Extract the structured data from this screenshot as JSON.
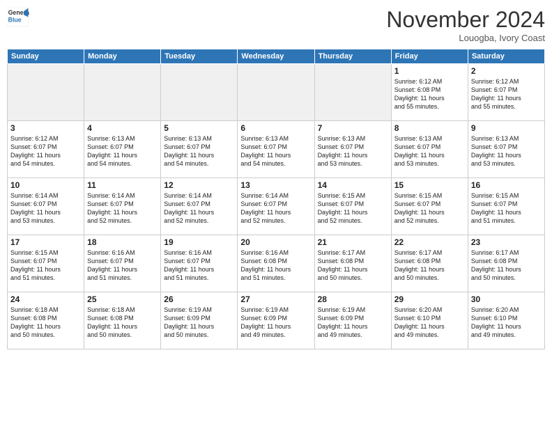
{
  "header": {
    "logo_line1": "General",
    "logo_line2": "Blue",
    "month": "November 2024",
    "location": "Louogba, Ivory Coast"
  },
  "weekdays": [
    "Sunday",
    "Monday",
    "Tuesday",
    "Wednesday",
    "Thursday",
    "Friday",
    "Saturday"
  ],
  "weeks": [
    [
      {
        "day": "",
        "info": ""
      },
      {
        "day": "",
        "info": ""
      },
      {
        "day": "",
        "info": ""
      },
      {
        "day": "",
        "info": ""
      },
      {
        "day": "",
        "info": ""
      },
      {
        "day": "1",
        "info": "Sunrise: 6:12 AM\nSunset: 6:08 PM\nDaylight: 11 hours\nand 55 minutes."
      },
      {
        "day": "2",
        "info": "Sunrise: 6:12 AM\nSunset: 6:07 PM\nDaylight: 11 hours\nand 55 minutes."
      }
    ],
    [
      {
        "day": "3",
        "info": "Sunrise: 6:12 AM\nSunset: 6:07 PM\nDaylight: 11 hours\nand 54 minutes."
      },
      {
        "day": "4",
        "info": "Sunrise: 6:13 AM\nSunset: 6:07 PM\nDaylight: 11 hours\nand 54 minutes."
      },
      {
        "day": "5",
        "info": "Sunrise: 6:13 AM\nSunset: 6:07 PM\nDaylight: 11 hours\nand 54 minutes."
      },
      {
        "day": "6",
        "info": "Sunrise: 6:13 AM\nSunset: 6:07 PM\nDaylight: 11 hours\nand 54 minutes."
      },
      {
        "day": "7",
        "info": "Sunrise: 6:13 AM\nSunset: 6:07 PM\nDaylight: 11 hours\nand 53 minutes."
      },
      {
        "day": "8",
        "info": "Sunrise: 6:13 AM\nSunset: 6:07 PM\nDaylight: 11 hours\nand 53 minutes."
      },
      {
        "day": "9",
        "info": "Sunrise: 6:13 AM\nSunset: 6:07 PM\nDaylight: 11 hours\nand 53 minutes."
      }
    ],
    [
      {
        "day": "10",
        "info": "Sunrise: 6:14 AM\nSunset: 6:07 PM\nDaylight: 11 hours\nand 53 minutes."
      },
      {
        "day": "11",
        "info": "Sunrise: 6:14 AM\nSunset: 6:07 PM\nDaylight: 11 hours\nand 52 minutes."
      },
      {
        "day": "12",
        "info": "Sunrise: 6:14 AM\nSunset: 6:07 PM\nDaylight: 11 hours\nand 52 minutes."
      },
      {
        "day": "13",
        "info": "Sunrise: 6:14 AM\nSunset: 6:07 PM\nDaylight: 11 hours\nand 52 minutes."
      },
      {
        "day": "14",
        "info": "Sunrise: 6:15 AM\nSunset: 6:07 PM\nDaylight: 11 hours\nand 52 minutes."
      },
      {
        "day": "15",
        "info": "Sunrise: 6:15 AM\nSunset: 6:07 PM\nDaylight: 11 hours\nand 52 minutes."
      },
      {
        "day": "16",
        "info": "Sunrise: 6:15 AM\nSunset: 6:07 PM\nDaylight: 11 hours\nand 51 minutes."
      }
    ],
    [
      {
        "day": "17",
        "info": "Sunrise: 6:15 AM\nSunset: 6:07 PM\nDaylight: 11 hours\nand 51 minutes."
      },
      {
        "day": "18",
        "info": "Sunrise: 6:16 AM\nSunset: 6:07 PM\nDaylight: 11 hours\nand 51 minutes."
      },
      {
        "day": "19",
        "info": "Sunrise: 6:16 AM\nSunset: 6:07 PM\nDaylight: 11 hours\nand 51 minutes."
      },
      {
        "day": "20",
        "info": "Sunrise: 6:16 AM\nSunset: 6:08 PM\nDaylight: 11 hours\nand 51 minutes."
      },
      {
        "day": "21",
        "info": "Sunrise: 6:17 AM\nSunset: 6:08 PM\nDaylight: 11 hours\nand 50 minutes."
      },
      {
        "day": "22",
        "info": "Sunrise: 6:17 AM\nSunset: 6:08 PM\nDaylight: 11 hours\nand 50 minutes."
      },
      {
        "day": "23",
        "info": "Sunrise: 6:17 AM\nSunset: 6:08 PM\nDaylight: 11 hours\nand 50 minutes."
      }
    ],
    [
      {
        "day": "24",
        "info": "Sunrise: 6:18 AM\nSunset: 6:08 PM\nDaylight: 11 hours\nand 50 minutes."
      },
      {
        "day": "25",
        "info": "Sunrise: 6:18 AM\nSunset: 6:08 PM\nDaylight: 11 hours\nand 50 minutes."
      },
      {
        "day": "26",
        "info": "Sunrise: 6:19 AM\nSunset: 6:09 PM\nDaylight: 11 hours\nand 50 minutes."
      },
      {
        "day": "27",
        "info": "Sunrise: 6:19 AM\nSunset: 6:09 PM\nDaylight: 11 hours\nand 49 minutes."
      },
      {
        "day": "28",
        "info": "Sunrise: 6:19 AM\nSunset: 6:09 PM\nDaylight: 11 hours\nand 49 minutes."
      },
      {
        "day": "29",
        "info": "Sunrise: 6:20 AM\nSunset: 6:10 PM\nDaylight: 11 hours\nand 49 minutes."
      },
      {
        "day": "30",
        "info": "Sunrise: 6:20 AM\nSunset: 6:10 PM\nDaylight: 11 hours\nand 49 minutes."
      }
    ]
  ]
}
